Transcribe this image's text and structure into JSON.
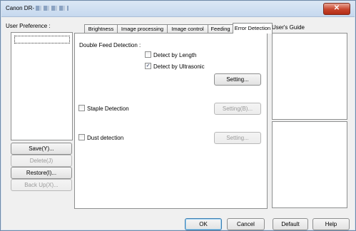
{
  "window": {
    "title": "Canon DR-",
    "close_glyph": "✕"
  },
  "left": {
    "user_preference_label": "User Preference :",
    "buttons": {
      "save": "Save(Y)...",
      "delete": "Delete(J)",
      "restore": "Restore(I)...",
      "backup": "Back Up(X)..."
    }
  },
  "tabs": [
    {
      "label": "Brightness"
    },
    {
      "label": "Image processing"
    },
    {
      "label": "Image control"
    },
    {
      "label": "Feeding"
    },
    {
      "label": "Error Detection"
    }
  ],
  "tab_scroll": {
    "left": "◀",
    "right": "▶"
  },
  "error_detection": {
    "double_feed_title": "Double Feed Detection :",
    "detect_by_length": {
      "label": "Detect by Length",
      "checked": false
    },
    "detect_by_ultrasonic": {
      "label": "Detect by Ultrasonic",
      "checked": true
    },
    "double_feed_setting": "Setting...",
    "staple": {
      "label": "Staple Detection",
      "checked": false
    },
    "staple_setting": "Setting(B)...",
    "dust": {
      "label": "Dust detection",
      "checked": false
    },
    "dust_setting": "Setting..."
  },
  "guide": {
    "label": "User's Guide"
  },
  "footer": {
    "ok": "OK",
    "cancel": "Cancel",
    "default": "Default",
    "help": "Help"
  },
  "colors": {
    "title_bar": "#c6d8ee",
    "close": "#c7442c",
    "check_mark": "#1b2f5f"
  }
}
